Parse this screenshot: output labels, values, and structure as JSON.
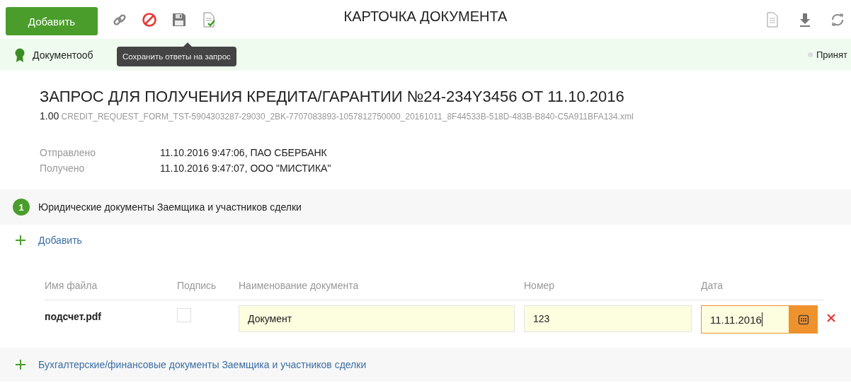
{
  "toolbar": {
    "add_button": "Добавить",
    "title": "КАРТОЧКА ДОКУМЕНТА",
    "tooltip": "Сохранить ответы на запрос"
  },
  "status_bar": {
    "text": "Документооб",
    "status": "Принят"
  },
  "document": {
    "title": "ЗАПРОС ДЛЯ ПОЛУЧЕНИЯ КРЕДИТА/ГАРАНТИИ №24-234Y3456 ОТ 11.10.2016",
    "version": "1.00",
    "filename": "CREDIT_REQUEST_FORM_TST-5904303287-29030_2BK-7707083893-1057812750000_20161011_8F44533B-518D-483B-B840-C5A911BFA134.xml",
    "meta": [
      {
        "label": "Отправлено",
        "value": "11.10.2016 9:47:06, ПАО СБЕРБАНК"
      },
      {
        "label": "Получено",
        "value": "11.10.2016 9:47:07, ООО \"МИСТИКА\""
      }
    ]
  },
  "section": {
    "number": "1",
    "title": "Юридические документы Заемщика и участников сделки",
    "add_link": "Добавить",
    "columns": [
      "Имя файла",
      "Подпись",
      "Наименование документа",
      "Номер",
      "Дата"
    ],
    "rows": [
      {
        "file": "подсчет.pdf",
        "signed": false,
        "name": "Документ",
        "number": "123",
        "date": "11.11.2016",
        "date_focused": true
      }
    ]
  },
  "more_sections": [
    {
      "title": "Бухгалтерские/финансовые документы Заемщика и участников сделки"
    }
  ]
}
